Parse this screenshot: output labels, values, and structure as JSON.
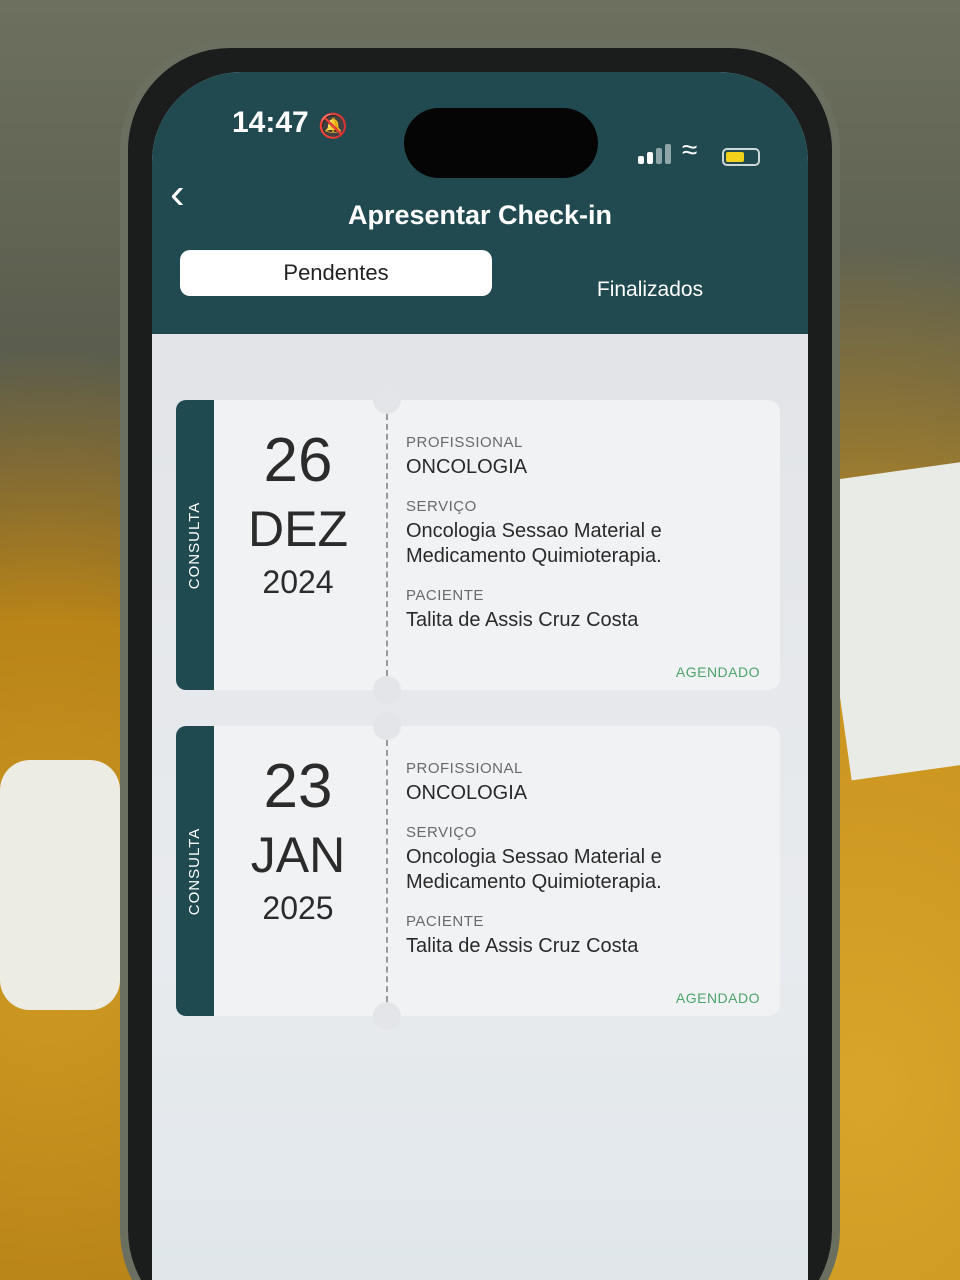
{
  "status_bar": {
    "time": "14:47",
    "bell_icon": "bell-slash-icon",
    "signal_icon": "signal-icon",
    "wifi_icon": "wifi-icon",
    "battery_icon": "battery-icon",
    "battery_color": "#f2d11a"
  },
  "header": {
    "back_icon": "chevron-left-icon",
    "title": "Apresentar Check-in",
    "background": "#204a4f"
  },
  "tabs": [
    {
      "label": "Pendentes",
      "active": true
    },
    {
      "label": "Finalizados",
      "active": false
    }
  ],
  "appointments": [
    {
      "type": "CONSULTA",
      "day": "26",
      "month": "DEZ",
      "year": "2024",
      "profissional_label": "PROFISSIONAL",
      "profissional": "ONCOLOGIA",
      "servico_label": "SERVIÇO",
      "servico": "Oncologia Sessao Material e Medicamento Quimioterapia.",
      "paciente_label": "PACIENTE",
      "paciente": "Talita de Assis Cruz Costa",
      "status": "AGENDADO"
    },
    {
      "type": "CONSULTA",
      "day": "23",
      "month": "JAN",
      "year": "2025",
      "profissional_label": "PROFISSIONAL",
      "profissional": "ONCOLOGIA",
      "servico_label": "SERVIÇO",
      "servico": "Oncologia Sessao Material e Medicamento Quimioterapia.",
      "paciente_label": "PACIENTE",
      "paciente": "Talita de Assis Cruz Costa",
      "status": "AGENDADO"
    }
  ],
  "colors": {
    "accent": "#1f4a50",
    "status": "#4da36a"
  }
}
